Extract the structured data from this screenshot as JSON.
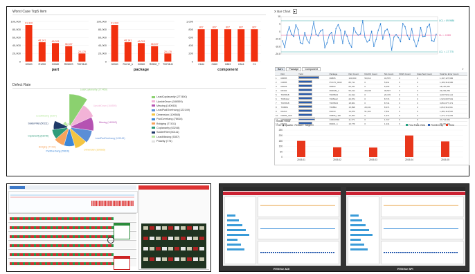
{
  "worst_case": {
    "title": "Worst Case Top5 Item",
    "charts": [
      {
        "axis_title": "part",
        "ymax_label": "100,000",
        "ticks": [
          "100,000",
          "80,000",
          "60,000",
          "40,000",
          "20,000",
          "0"
        ],
        "categories": [
          "00000",
          "R1250",
          "C0080",
          "R0500S",
          "T0078LB"
        ],
        "values": [
          91310,
          48141,
          46031,
          38537,
          20170
        ],
        "value_labels": [
          "91,310",
          "48,141",
          "46,031",
          "38,537",
          "20,170"
        ]
      },
      {
        "axis_title": "package",
        "ticks": [
          "100,000",
          "80,000",
          "60,000",
          "40,000",
          "20,000",
          "0"
        ],
        "categories": [
          "00000",
          "R1210_b",
          "C0080",
          "R0500_T",
          "T0078LB"
        ],
        "values": [
          91310,
          48141,
          46031,
          38537,
          20170
        ],
        "value_labels": [
          "91,310",
          "48,141",
          "46,031",
          "38,537",
          "20,170"
        ]
      },
      {
        "axis_title": "component",
        "ticks": [
          "1,000",
          "800",
          "600",
          "400",
          "200",
          "0"
        ],
        "categories": [
          "C644",
          "C840",
          "C883",
          "C844",
          "C1"
        ],
        "values": [
          807,
          807,
          807,
          807,
          807
        ],
        "value_labels": [
          "807",
          "807",
          "807",
          "807",
          "807"
        ]
      }
    ]
  },
  "defect_rate": {
    "title": "Defect Rate",
    "slices": [
      {
        "label": "LeadCoplanarity",
        "value": 277450,
        "color": "#8bd16f"
      },
      {
        "label": "UpsideDown",
        "value": 166559,
        "color": "#f2b3d7"
      },
      {
        "label": "Missing",
        "value": 140063,
        "color": "#b553b2"
      },
      {
        "label": "LeadOverhang",
        "value": 122149,
        "color": "#5b8ed6"
      },
      {
        "label": "Dimension",
        "value": 109565,
        "color": "#f4c542"
      },
      {
        "label": "PadOverhang",
        "value": 78616,
        "color": "#3a86d9"
      },
      {
        "label": "Bridging",
        "value": 77431,
        "color": "#f7a35c"
      },
      {
        "label": "Coplanarity",
        "value": 63248,
        "color": "#2e9c7a"
      },
      {
        "label": "SolderFillet",
        "value": 50111,
        "color": "#1f3a68"
      },
      {
        "label": "LeadMissing",
        "value": 5357,
        "color": "#b8e8a0"
      },
      {
        "label": "Polarity",
        "value": 774,
        "color": "#e0e0e0"
      }
    ],
    "legend": [
      "LeadCoplanarity (277450)",
      "UpsideDown (166559)",
      "Missing (140063)",
      "LeadPadOverhang (122149)",
      "Dimension (109565)",
      "PadOverhang (78616)",
      "Bridging (77431)",
      "Coplanarity (63248)",
      "SolderFillet (50111)",
      "LeadMissing (5357)",
      "Polarity (774)"
    ],
    "outer_labels": [
      "LeadCoplanarity (277450)",
      "UpsideDown (166559)",
      "Missing (140063)",
      "LeadPadOverhang (122149)",
      "Dimension (109565)",
      "PadOverhang (78616)",
      "Bridging (77431)",
      "Coplanarity (63248)",
      "SolderFillet (50111)",
      "LeadMissing (5357)"
    ]
  },
  "xbar": {
    "title": "X Bar Chart",
    "right_labels": [
      "UCL = 89.9986",
      "CL = -0.000",
      "LCL = -17.775"
    ],
    "ticks": [
      "18",
      "9",
      "0",
      "-10.8",
      "-18.8",
      "-26.8"
    ]
  },
  "tabs": [
    "Bars",
    "Package",
    "Component"
  ],
  "table": {
    "headers": [
      "",
      "Part",
      "Yield",
      "Package",
      "Part Count",
      "NG/OK Count",
      "NG Count",
      "PASS Count",
      "Data Test Count",
      "Total No Error Count"
    ],
    "rows": [
      [
        "1",
        "R0805",
        "",
        "R0805",
        "100,000",
        "50,614",
        "49,576",
        "0",
        "0",
        "1,197,127,982"
      ],
      [
        "2",
        "C0805",
        "",
        "PCC70_0402",
        "80,711",
        "0",
        "5,911",
        "0",
        "0",
        "1,183,313,990"
      ],
      [
        "3",
        "R0603",
        "",
        "R0603",
        "60,151",
        "0",
        "6,004",
        "0",
        "0",
        "18,187,651"
      ],
      [
        "4",
        "R0402",
        "",
        "R0402E_1",
        "50,214",
        "20,048",
        "38,537",
        "0",
        "0",
        "23,262,254"
      ],
      [
        "5",
        "T0078LB",
        "",
        "T0078LB",
        "21,914",
        "0",
        "20,170",
        "0",
        "0",
        "4,637,521,114"
      ],
      [
        "6",
        "T0054A2",
        "",
        "T0054A2",
        "20,874",
        "0",
        "8,774",
        "0",
        "0",
        "1,523,097,501"
      ],
      [
        "7",
        "T0078LB",
        "",
        "T0078LB",
        "18,821",
        "0",
        "8,741",
        "0",
        "0",
        "3,861,077,471"
      ],
      [
        "8",
        "T0088A",
        "",
        "T0088A",
        "15,898",
        "29,241",
        "8,371",
        "0",
        "0",
        "1,813,311,911"
      ],
      [
        "9",
        "R1210",
        "",
        "R1210",
        "13,870",
        "51,104",
        "7,811",
        "0",
        "0",
        "1,481,114,510"
      ],
      [
        "10",
        "D0805_LED",
        "",
        "D0805_LED",
        "12,364",
        "0",
        "1,971",
        "0",
        "0",
        "1,371,171,681"
      ],
      [
        "11",
        "C0603X5R",
        "",
        "C0603X5R",
        "11,771",
        "0",
        "1,717",
        "0",
        "0",
        "37,714,561"
      ],
      [
        "12",
        "R0201",
        "",
        "R0201_1",
        "10,776",
        "0",
        "1,441",
        "0",
        "0",
        "31,481,714"
      ]
    ]
  },
  "small_yield": {
    "title": "Small Yield",
    "controls": [
      "ID",
      "Quarter",
      "Period",
      "Target"
    ],
    "legend": [
      "First Pass Yield",
      "FinGB Chip",
      "Yield"
    ],
    "bars": [
      {
        "x": "2019-01",
        "v": 150
      },
      {
        "x": "2019-02",
        "v": 90
      },
      {
        "x": "2019-03",
        "v": 88
      },
      {
        "x": "2019-04",
        "v": 200
      },
      {
        "x": "2019-05",
        "v": 145
      }
    ],
    "ticks": [
      "250",
      "200",
      "150",
      "100",
      "50",
      "0"
    ]
  },
  "captions": [
    "RTM for AOI",
    "RTM for SPI"
  ]
}
